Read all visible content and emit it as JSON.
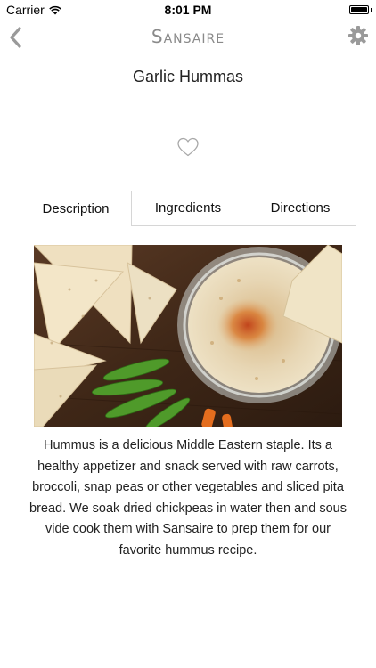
{
  "status_bar": {
    "carrier": "Carrier",
    "time": "8:01 PM",
    "battery_level": 1.0
  },
  "nav": {
    "brand": "Sansaire",
    "back_icon": "chevron-left-icon",
    "settings_icon": "gear-icon"
  },
  "recipe": {
    "title": "Garlic Hummas",
    "favorite_icon": "heart-outline-icon",
    "description": "Hummus is a delicious Middle Eastern staple. Its a healthy appetizer and snack served with raw carrots, broccoli, snap peas or other vegetables and sliced pita bread.  We soak dried chickpeas in water then and sous vide cook them with Sansaire to prep them for our favorite hummus recipe."
  },
  "tabs": [
    {
      "label": "Description",
      "active": true
    },
    {
      "label": "Ingredients",
      "active": false
    },
    {
      "label": "Directions",
      "active": false
    }
  ],
  "colors": {
    "brand_gray": "#8a8a8a",
    "tab_border": "#d6d6d6",
    "icon_gray": "#9a9a9a"
  }
}
